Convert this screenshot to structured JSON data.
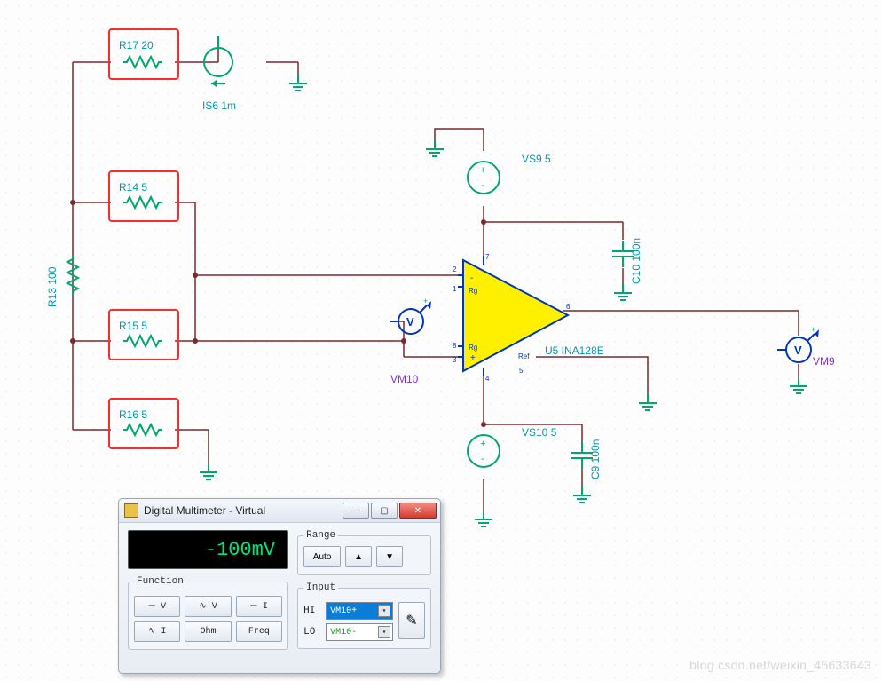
{
  "schematic": {
    "resistors": {
      "R17": {
        "name": "R17",
        "value": "20",
        "label": "R17 20"
      },
      "R14": {
        "name": "R14",
        "value": "5",
        "label": "R14 5"
      },
      "R15": {
        "name": "R15",
        "value": "5",
        "label": "R15 5"
      },
      "R16": {
        "name": "R16",
        "value": "5",
        "label": "R16 5"
      },
      "R13": {
        "name": "R13",
        "value": "100",
        "label": "R13 100"
      }
    },
    "sources": {
      "IS6": {
        "name": "IS6",
        "value": "1m",
        "label": "IS6 1m",
        "type": "current"
      },
      "VS9": {
        "name": "VS9",
        "value": "5",
        "label": "VS9 5",
        "type": "voltage"
      },
      "VS10": {
        "name": "VS10",
        "value": "5",
        "label": "VS10 5",
        "type": "voltage"
      }
    },
    "capacitors": {
      "C10": {
        "name": "C10",
        "value": "100n",
        "label": "C10 100n"
      },
      "C9": {
        "name": "C9",
        "value": "100n",
        "label": "C9 100n"
      }
    },
    "amp": {
      "ref": "U5",
      "part": "INA128E",
      "label": "U5 INA128E",
      "pin_labels": {
        "1": "1",
        "2": "2",
        "3": "3",
        "4": "4",
        "5": "5",
        "6": "6",
        "7": "7",
        "8": "8",
        "Rg_top": "Rg",
        "Rg_bot": "Rg",
        "Ref": "Ref",
        "minus": "-",
        "plus": "+"
      }
    },
    "meters": {
      "VM10": {
        "name": "VM10",
        "label": "VM10"
      },
      "VM9": {
        "name": "VM9",
        "label": "VM9"
      }
    }
  },
  "dmm": {
    "title": "Digital Multimeter - Virtual",
    "display": "-100mV",
    "groups": {
      "function": "Function",
      "range": "Range",
      "input": "Input"
    },
    "function_buttons": {
      "dc_v": "⎓ V",
      "ac_v": "∿ V",
      "dc_i": "⎓ I",
      "ac_i": "∿ I",
      "ohm": "Ohm",
      "freq": "Freq"
    },
    "range_buttons": {
      "auto": "Auto",
      "up": "▲",
      "down": "▼"
    },
    "input": {
      "hi_label": "HI",
      "hi_value": "VM10+",
      "lo_label": "LO",
      "lo_value": "VM10-"
    },
    "window_buttons": {
      "min": "—",
      "max": "▢",
      "close": "✕"
    },
    "probe_icon": "✎"
  },
  "watermark": "blog.csdn.net/weixin_45633643"
}
